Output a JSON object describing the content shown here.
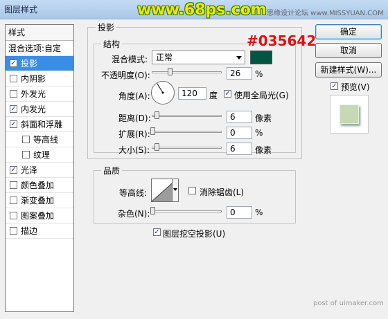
{
  "window": {
    "title": "图层样式"
  },
  "watermark": {
    "text": "www.68ps.com",
    "site_note": "思缘设计论坛 www.MISSYUAN.COM"
  },
  "annotation": {
    "hex": "#035642"
  },
  "styles_list": {
    "header": "样式",
    "blend_options": "混合选项:自定",
    "items": [
      {
        "label": "投影",
        "checked": true,
        "selected": true,
        "indent": false
      },
      {
        "label": "内阴影",
        "checked": false,
        "selected": false,
        "indent": false
      },
      {
        "label": "外发光",
        "checked": false,
        "selected": false,
        "indent": false
      },
      {
        "label": "内发光",
        "checked": true,
        "selected": false,
        "indent": false
      },
      {
        "label": "斜面和浮雕",
        "checked": true,
        "selected": false,
        "indent": false
      },
      {
        "label": "等高线",
        "checked": false,
        "selected": false,
        "indent": true
      },
      {
        "label": "纹理",
        "checked": false,
        "selected": false,
        "indent": true
      },
      {
        "label": "光泽",
        "checked": true,
        "selected": false,
        "indent": false
      },
      {
        "label": "颜色叠加",
        "checked": false,
        "selected": false,
        "indent": false
      },
      {
        "label": "渐变叠加",
        "checked": false,
        "selected": false,
        "indent": false
      },
      {
        "label": "图案叠加",
        "checked": false,
        "selected": false,
        "indent": false
      },
      {
        "label": "描边",
        "checked": false,
        "selected": false,
        "indent": false
      }
    ]
  },
  "drop_shadow": {
    "section_title": "投影",
    "structure_title": "结构",
    "blend_mode_label": "混合模式:",
    "blend_mode_value": "正常",
    "shadow_color": "#035642",
    "opacity_label": "不透明度(O):",
    "opacity_value": "26",
    "opacity_fraction": 0.26,
    "percent": "%",
    "angle_label": "角度(A):",
    "angle_value": "120",
    "angle_unit": "度",
    "global_light_label": "使用全局光(G)",
    "global_light_checked": true,
    "distance_label": "距离(D):",
    "distance_value": "6",
    "spread_label": "扩展(R):",
    "spread_value": "0",
    "size_label": "大小(S):",
    "size_value": "6",
    "pixels_unit": "像素",
    "quality_title": "品质",
    "contour_label": "等高线:",
    "anti_alias_label": "消除锯齿(L)",
    "anti_alias_checked": false,
    "noise_label": "杂色(N):",
    "noise_value": "0",
    "knockout_label": "图层挖空投影(U)",
    "knockout_checked": true
  },
  "buttons": {
    "ok": "确定",
    "cancel": "取消",
    "new_style": "新建样式(W)...",
    "preview_label": "预览(V)",
    "preview_checked": true
  },
  "footer": {
    "note": "post of uimaker.com"
  }
}
